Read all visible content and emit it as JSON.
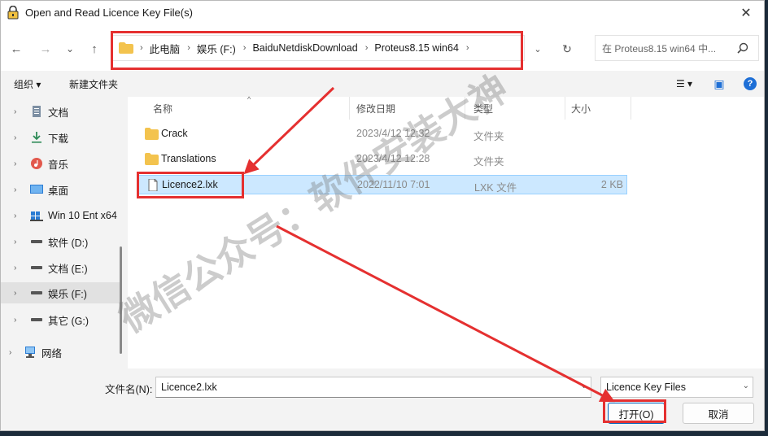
{
  "window": {
    "title": "Open and Read Licence Key File(s)",
    "close_glyph": "✕"
  },
  "nav": {
    "back_glyph": "←",
    "forward_glyph": "→",
    "recent_glyph": "⌄",
    "up_glyph": "↑",
    "breadcrumbs": [
      "此电脑",
      "娱乐 (F:)",
      "BaiduNetdiskDownload",
      "Proteus8.15 win64"
    ],
    "sep_glyph": "›",
    "dropdown_glyph": "⌄",
    "refresh_glyph": "↻",
    "search_placeholder": "在 Proteus8.15 win64 中..."
  },
  "toolbar": {
    "organize": "组织 ▾",
    "new_folder": "新建文件夹",
    "view_glyph": "☰ ▾",
    "pane_glyph": "▣",
    "help_glyph": "?"
  },
  "sidebar": {
    "chevron": "›",
    "items": [
      {
        "label": "文档",
        "icon": "document-icon"
      },
      {
        "label": "下载",
        "icon": "download-icon"
      },
      {
        "label": "音乐",
        "icon": "music-icon"
      },
      {
        "label": "桌面",
        "icon": "desktop-icon"
      },
      {
        "label": "Win 10 Ent x64",
        "icon": "drive-icon"
      },
      {
        "label": "软件 (D:)",
        "icon": "drive-icon"
      },
      {
        "label": "文档 (E:)",
        "icon": "drive-icon"
      },
      {
        "label": "娱乐 (F:)",
        "icon": "drive-icon",
        "selected": true
      },
      {
        "label": "其它 (G:)",
        "icon": "drive-icon"
      },
      {
        "label": "网络",
        "icon": "network-icon"
      }
    ]
  },
  "list": {
    "columns": {
      "name": "名称",
      "modified": "修改日期",
      "type": "类型",
      "size": "大小"
    },
    "sort_glyph": "^",
    "rows": [
      {
        "name": "Crack",
        "modified": "2023/4/12 12:32",
        "type": "文件夹",
        "size": "",
        "icon": "folder-icon"
      },
      {
        "name": "Translations",
        "modified": "2023/4/12 12:28",
        "type": "文件夹",
        "size": "",
        "icon": "folder-icon"
      },
      {
        "name": "Licence2.lxk",
        "modified": "2022/11/10 7:01",
        "type": "LXK 文件",
        "size": "2 KB",
        "icon": "file-icon",
        "selected": true
      }
    ]
  },
  "footer": {
    "filename_label": "文件名(N):",
    "filename_value": "Licence2.lxk",
    "filename_dd": "⌄",
    "filetype": "Licence Key Files",
    "filetype_dd": "⌄",
    "open_label": "打开(O)",
    "cancel_label": "取消"
  },
  "watermark": {
    "text": "微信公众号：软件安装大神"
  },
  "colors": {
    "annotation": "#e53030",
    "selection": "#cce8ff",
    "folder": "#f3c34e"
  }
}
